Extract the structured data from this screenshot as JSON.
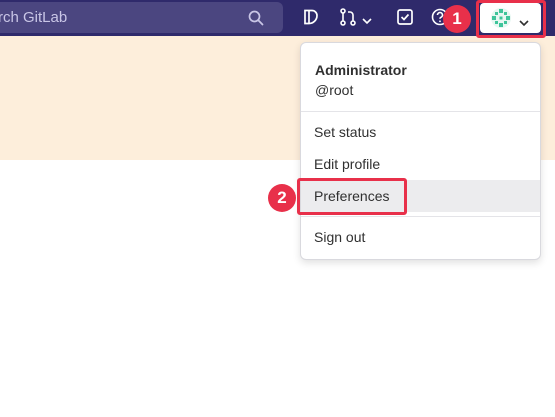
{
  "navbar": {
    "search_placeholder": "Search GitLab",
    "search_visible_text": "rch GitLab",
    "icons": [
      "search-icon",
      "issues-icon",
      "merge-request-icon",
      "todo-icon",
      "help-icon",
      "avatar-icon"
    ]
  },
  "annotations": {
    "step_1": "1",
    "step_2": "2",
    "highlight_color": "#e8304a"
  },
  "user_menu": {
    "display_name": "Administrator",
    "username": "@root",
    "items": [
      {
        "label": "Set status"
      },
      {
        "label": "Edit profile"
      },
      {
        "label": "Preferences",
        "highlighted": true
      },
      {
        "label": "Sign out"
      }
    ]
  },
  "colors": {
    "navbar_bg": "#2f2a6b",
    "banner_bg": "#fdeedb",
    "accent": "#e8304a"
  }
}
